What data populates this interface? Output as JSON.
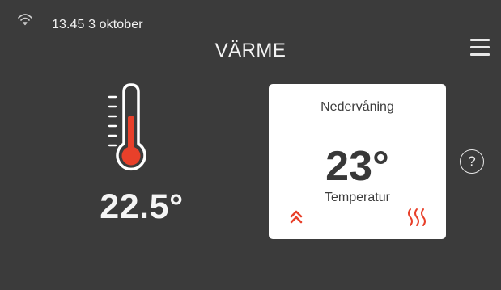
{
  "status_bar": {
    "datetime": "13.45 3 oktober",
    "wifi_icon": "wifi-icon"
  },
  "header": {
    "title": "VÄRME",
    "menu_icon": "hamburger-menu-icon"
  },
  "current_temperature": {
    "value": "22.5°",
    "icon": "thermometer-icon"
  },
  "zone_card": {
    "zone": "Nedervåning",
    "setpoint": "23°",
    "label": "Temperatur",
    "left_icon": "double-chevron-up-icon",
    "right_icon": "heating-icon"
  },
  "help": {
    "label": "?",
    "icon": "help-icon"
  },
  "colors": {
    "background": "#3b3b3b",
    "card": "#ffffff",
    "accent_red": "#e8402a",
    "text_light": "#ffffff",
    "text_dark": "#383838"
  }
}
